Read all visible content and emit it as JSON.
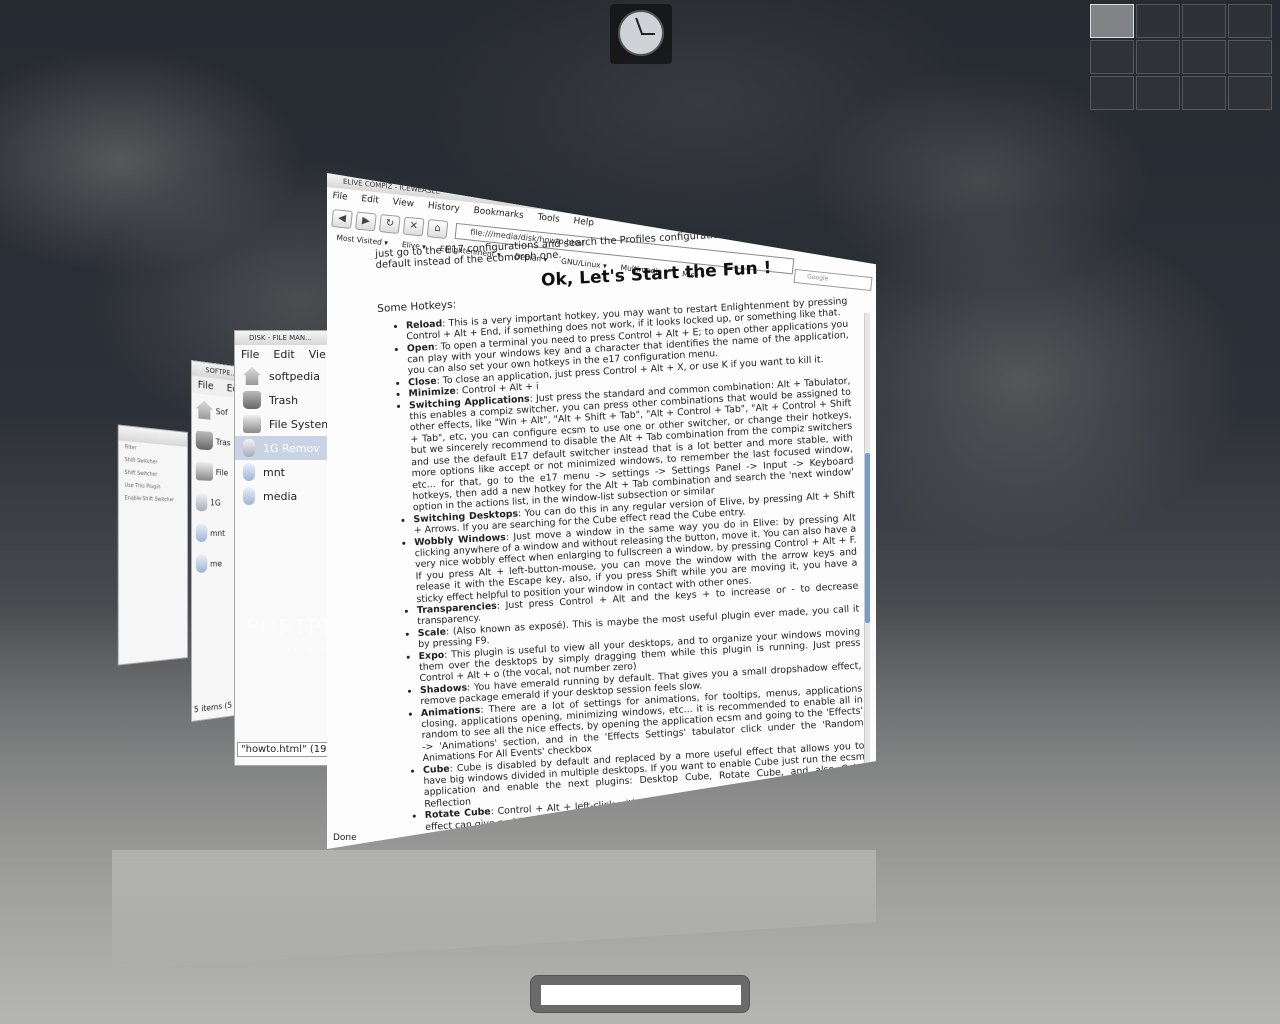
{
  "clock": {
    "icon": "clock-icon"
  },
  "pager": {
    "desktops": 12,
    "active_index": 0
  },
  "window_far": {
    "rows": [
      "Filter",
      "Shift Switcher",
      "Shift Switcher",
      "Use This Plugin",
      "Enable Shift Switcher"
    ]
  },
  "window_fm1": {
    "title": "SOFTPE...",
    "menu": [
      "File",
      "Ed"
    ],
    "items": [
      {
        "label": "Sof",
        "icon": "home-icon"
      },
      {
        "label": "Tras",
        "icon": "trash-icon"
      },
      {
        "label": "File",
        "icon": "disk-icon"
      },
      {
        "label": "1G",
        "icon": "usb-icon"
      },
      {
        "label": "mnt",
        "icon": "folder-icon"
      },
      {
        "label": "me",
        "icon": "folder-icon"
      }
    ],
    "status": "5 items (5"
  },
  "window_fm2": {
    "title": "DISK - FILE MAN...",
    "menu": [
      "File",
      "Edit",
      "Vie"
    ],
    "items": [
      {
        "label": "softpedia",
        "icon": "home-icon"
      },
      {
        "label": "Trash",
        "icon": "trash-icon"
      },
      {
        "label": "File System",
        "icon": "disk-icon"
      },
      {
        "label": "1G Remov",
        "icon": "usb-icon",
        "selected": true
      },
      {
        "label": "mnt",
        "icon": "folder-icon"
      },
      {
        "label": "media",
        "icon": "folder-icon"
      }
    ],
    "status": "\"howto.html\" (19"
  },
  "browser": {
    "title": "ELIVE COMPIZ - ICEWEASEL",
    "menu": [
      "File",
      "Edit",
      "View",
      "History",
      "Bookmarks",
      "Tools",
      "Help"
    ],
    "url": "file:///media/disk/howto.html",
    "bookmarks": [
      "Most Visited ▾",
      "Elive ▾",
      "Enlightenment ▾",
      "Debian ▾",
      "GNU/Linux ▾",
      "Multimedia ▾",
      "Misc ▾"
    ],
    "search_placeholder": "Google",
    "status": "Done",
    "intro": "just go to the E17 configurations and search the Profiles configurations, then select the default instead of the ecomorph one.",
    "heading": "Ok, Let's Start the Fun !",
    "subheading": "Some Hotkeys:",
    "hotkeys": [
      {
        "name": "Reload",
        "text": ": This is a very important hotkey, you may want to restart Enlightenment by pressing Control + Alt + End, if something does not work, if it looks locked up, or something like that."
      },
      {
        "name": "Open",
        "text": ": To open a terminal you need to press Control + Alt + E; to open other applications you can play with your windows key and a character that identifies the name of the application, you can also set your own hotkeys in the e17 configuration menu."
      },
      {
        "name": "Close",
        "text": ": To close an application, just press Control + Alt + X, or use K if you want to kill it."
      },
      {
        "name": "Minimize",
        "text": ": Control + Alt + i"
      },
      {
        "name": "Switching Applications",
        "text": ": Just press the standard and common combination: Alt + Tabulator, this enables a compiz switcher, you can press other combinations that would be assigned to other effects, like \"Win + Alt\", \"Alt + Shift + Tab\", \"Alt + Control + Tab\", \"Alt + Control + Shift + Tab\", etc, you can configure ecsm to use one or other switcher, or change their hotkeys, but we sincerely recommend to disable the Alt + Tab combination from the compiz switchers and use the default E17 default switcher instead that is a lot better and more stable, with more options like accept or not minimized windows, to remember the last focused window, etc... for that, go to the e17 menu -> settings -> Settings Panel -> Input -> Keyboard hotkeys, then add a new hotkey for the Alt + Tab combination and search the 'next window' option in the actions list, in the window-list subsection or similar"
      },
      {
        "name": "Switching Desktops",
        "text": ": You can do this in any regular version of Elive, by pressing Alt + Shift + Arrows. If you are searching for the Cube effect read the Cube entry."
      },
      {
        "name": "Wobbly Windows",
        "text": ": Just move a window in the same way you do in Elive: by pressing Alt clicking anywhere of a window and without releasing the button, move it. You can also have a very nice wobbly effect when enlarging to fullscreen a window, by pressing Control + Alt + F. If you press Alt + left-button-mouse, you can move the window with the arrow keys and release it with the Escape key, also, if you press Shift while you are moving it, you have a sticky effect helpful to position your window in contact with other ones."
      },
      {
        "name": "Transparencies",
        "text": ": Just press Control + Alt and the keys + to increase or - to decrease transparency."
      },
      {
        "name": "Scale",
        "text": ": (Also known as exposé). This is maybe the most useful plugin ever made, you call it by pressing F9."
      },
      {
        "name": "Expo",
        "text": ": This plugin is useful to view all your desktops, and to organize your windows moving them over the desktops by simply dragging them while this plugin is running. Just press Control + Alt + o (the vocal, not number zero)"
      },
      {
        "name": "Shadows",
        "text": ": You have emerald running by default. That gives you a small dropshadow effect, remove package emerald if your desktop session feels slow."
      },
      {
        "name": "Animations",
        "text": ": There are a lot of settings for animations, for tooltips, menus, applications closing, applications opening, minimizing windows, etc... it is recommended to enable all in random to see all the nice effects, by opening the application ecsm and going to the 'Effects' -> 'Animations' section, and in the 'Effects Settings' tabulator click under the 'Random Animations For All Events' checkbox"
      },
      {
        "name": "Cube",
        "text": ": Cube is disabled by default and replaced by a more useful effect that allows you to have big windows divided in multiple desktops. If you want to enable Cube just run the ecsm application and enable the next plugins: Desktop Cube, Rotate Cube, and also Cube Reflection"
      },
      {
        "name": "Rotate Cube",
        "text": ": Control + Alt + left-click with the mouse and without releasing, move it, this effect can give problems in some Graphic cards."
      }
    ]
  },
  "watermark": {
    "text": "SOFTPEDIA",
    "url": "www.softpedia.com"
  }
}
